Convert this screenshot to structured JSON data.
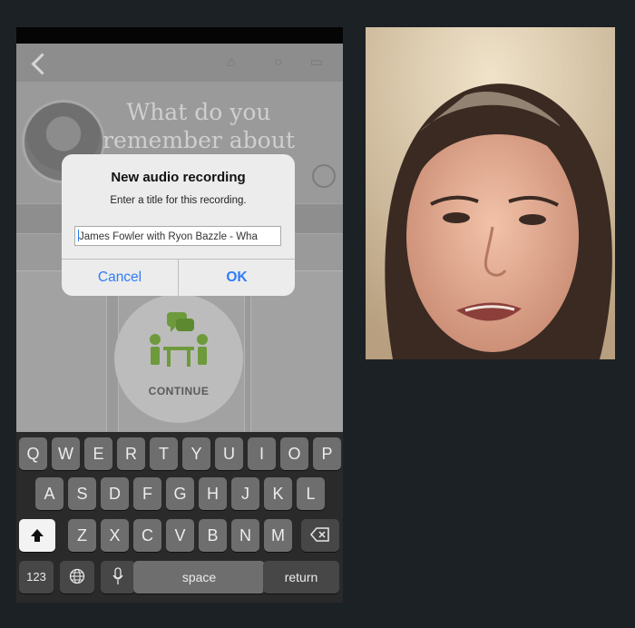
{
  "app": {
    "question": "What do you remember about",
    "continue_label": "CONTINUE"
  },
  "alert": {
    "title": "New audio recording",
    "message": "Enter a title for this recording.",
    "input_value": "James Fowler with Ryon Bazzle - Wha",
    "cancel_label": "Cancel",
    "ok_label": "OK"
  },
  "keyboard": {
    "row1": [
      "Q",
      "W",
      "E",
      "R",
      "T",
      "Y",
      "U",
      "I",
      "O",
      "P"
    ],
    "row2": [
      "A",
      "S",
      "D",
      "F",
      "G",
      "H",
      "J",
      "K",
      "L"
    ],
    "row3": [
      "Z",
      "X",
      "C",
      "V",
      "B",
      "N",
      "M"
    ],
    "numbers_label": "123",
    "space_label": "space",
    "return_label": "return"
  },
  "colors": {
    "accent": "#2f7cf6",
    "continue_icon": "#6e9a3c",
    "page_background": "#1c2126"
  }
}
